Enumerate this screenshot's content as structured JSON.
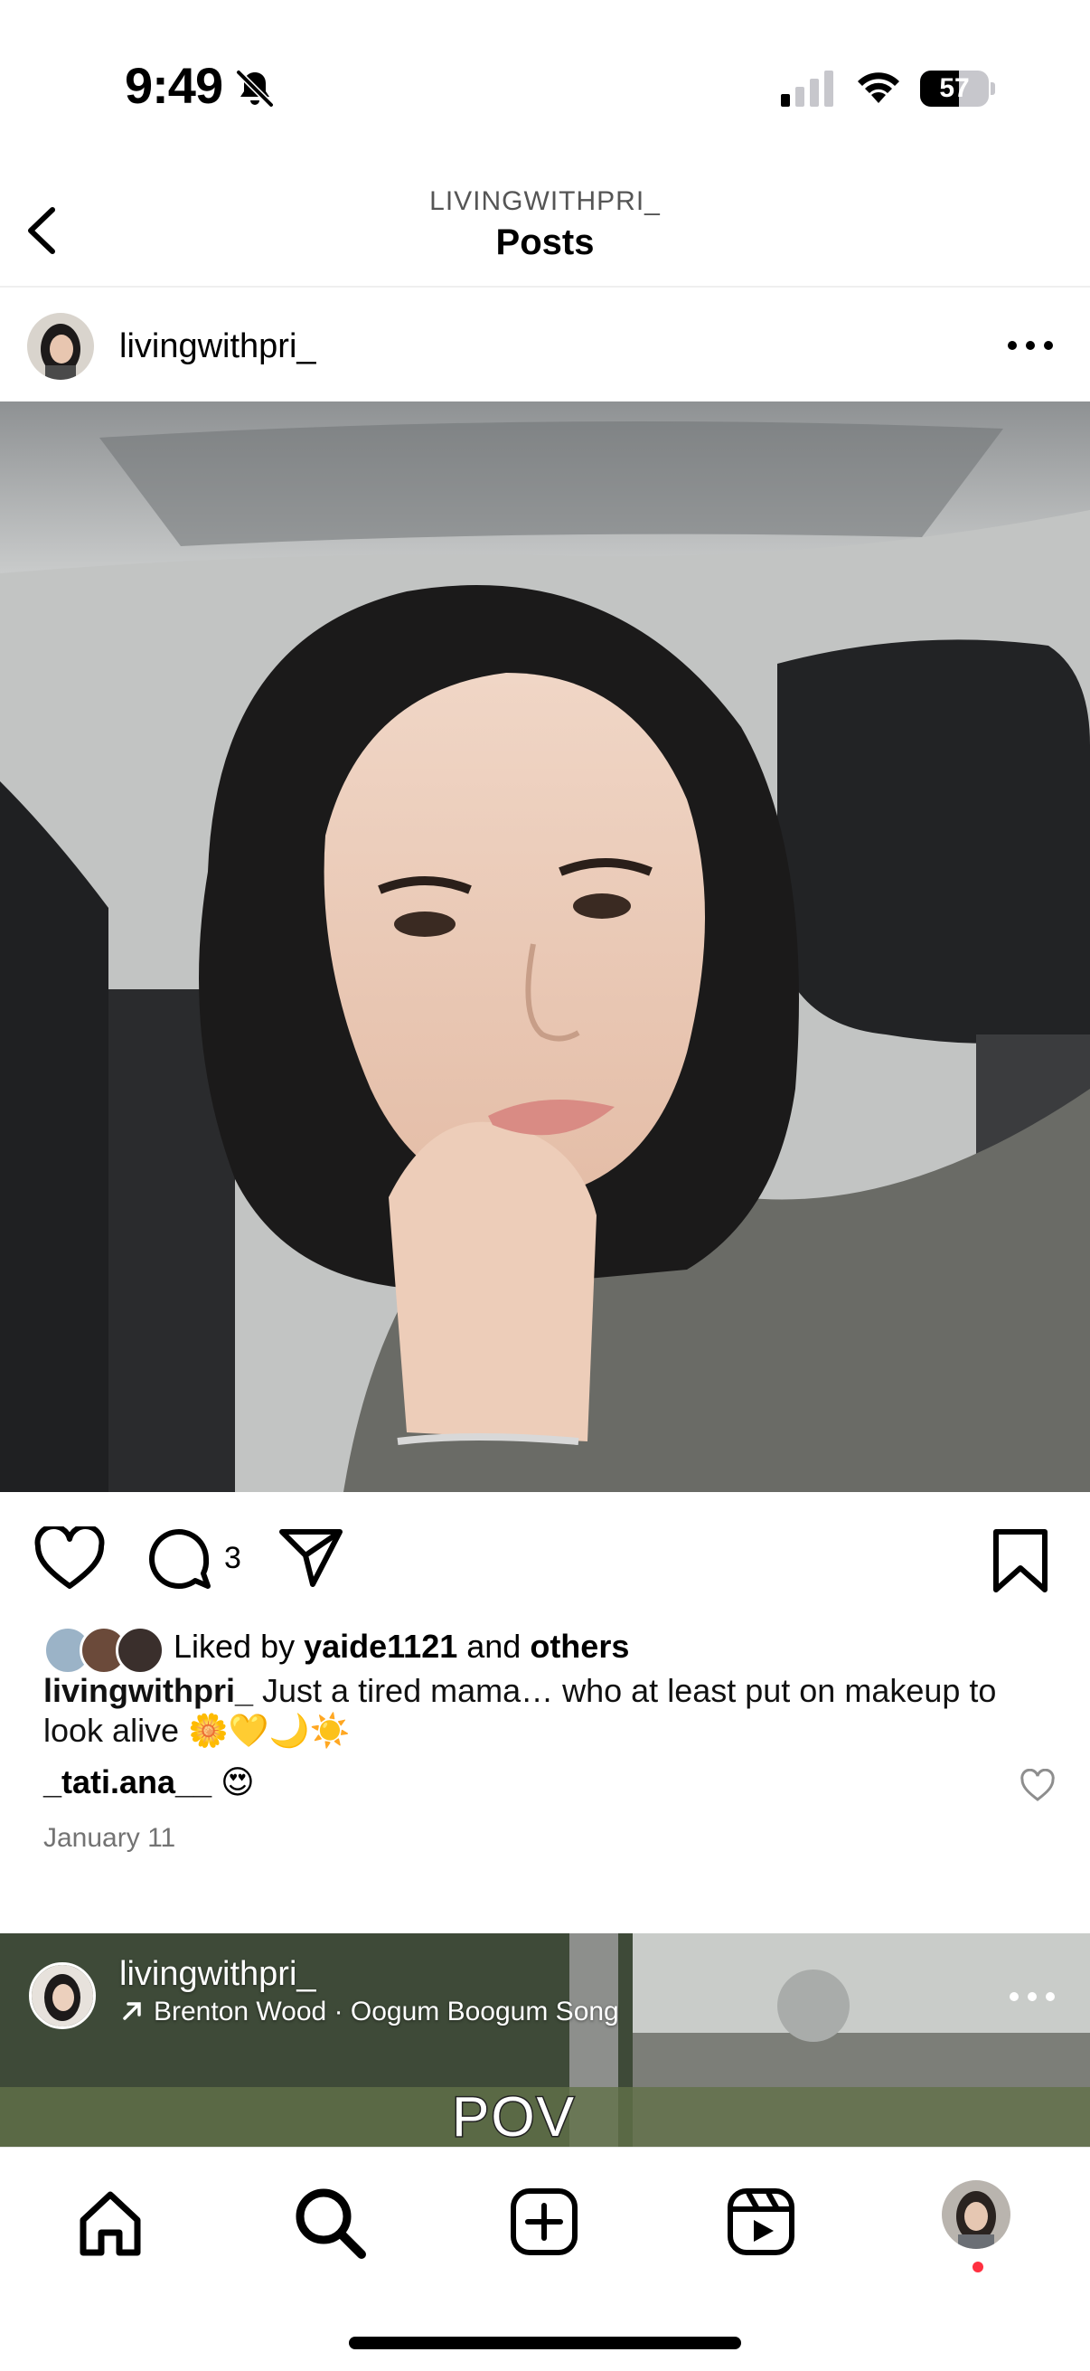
{
  "status_bar": {
    "time": "9:49",
    "battery": "57",
    "battery_level": 0.57,
    "silent_icon": "bell-slash-icon",
    "signal_icon": "cellular-signal-icon",
    "wifi_icon": "wifi-icon"
  },
  "header": {
    "subtitle": "LIVINGWITHPRI_",
    "title": "Posts",
    "back_icon": "chevron-left-icon"
  },
  "post": {
    "username": "livingwithpri_",
    "more_icon": "more-horizontal-icon",
    "photo_description_icon": "photo",
    "comment_count": "3",
    "likes": {
      "prefix": "Liked by ",
      "user": "yaide1121",
      "middle": " and ",
      "suffix": "others"
    },
    "caption": {
      "username": "livingwithpri_",
      "text": " Just a tired mama… who at least put on makeup to look alive 🌼💛🌙☀️"
    },
    "comment": {
      "username": "_tati.ana__",
      "text": " 😍"
    },
    "date": "January 11"
  },
  "next_post": {
    "username": "livingwithpri_",
    "music": "Brenton Wood · Oogum Boogum Song",
    "overlay_text": "POV"
  },
  "tab_bar": {
    "items": [
      "home-icon",
      "search-icon",
      "create-icon",
      "reels-icon",
      "profile-avatar"
    ]
  },
  "colors": {
    "accent_dot": "#ff3040",
    "secondary_text": "#737373"
  }
}
